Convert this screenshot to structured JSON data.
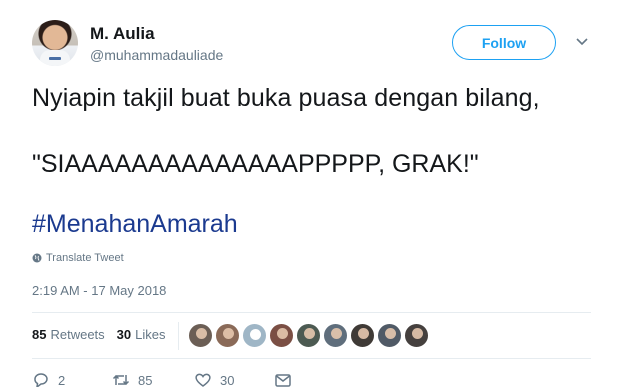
{
  "author": {
    "name": "M. Aulia",
    "handle": "@muhammadauliade",
    "avatar_icon": "user-avatar"
  },
  "header": {
    "follow_label": "Follow",
    "more_icon": "chevron-down-icon"
  },
  "tweet": {
    "line1": "Nyiapin takjil buat buka puasa dengan bilang,",
    "line2": "\"SIAAAAAAAAAAAAAAPPPPP, GRAK!\"",
    "hashtag": "#MenahanAmarah",
    "translate_label": "Translate Tweet",
    "timestamp": "2:19 AM - 17 May 2018"
  },
  "stats": {
    "retweets_count": "85",
    "retweets_label": "Retweets",
    "likes_count": "30",
    "likes_label": "Likes"
  },
  "likers": [
    {
      "color": "#6b5e55"
    },
    {
      "color": "#8a6a58"
    },
    {
      "color": "#9fb6c6",
      "plain": true
    },
    {
      "color": "#7b4f44"
    },
    {
      "color": "#4c5a52"
    },
    {
      "color": "#5f6e7c"
    },
    {
      "color": "#3f3a36"
    },
    {
      "color": "#505a66"
    },
    {
      "color": "#45403e"
    }
  ],
  "actions": {
    "reply_count": "2",
    "retweet_count": "85",
    "like_count": "30"
  },
  "colors": {
    "link": "#1da1f2",
    "hashtag": "#1b3a8f",
    "muted": "#657786",
    "text": "#14171a"
  }
}
